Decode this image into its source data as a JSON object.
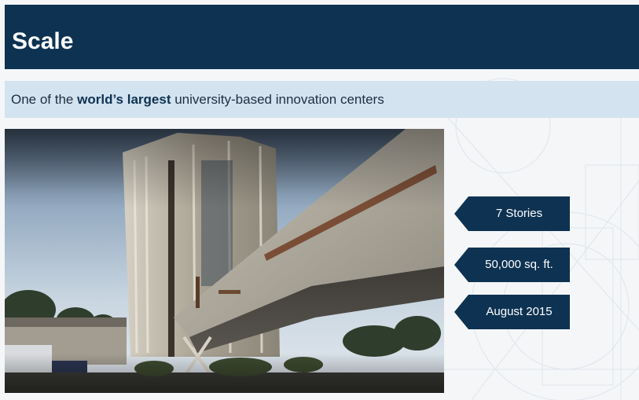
{
  "slide": {
    "title": "Scale",
    "subtitle": {
      "prefix": "One of the ",
      "emphasis": "world’s largest",
      "suffix": " university-based innovation centers"
    }
  },
  "stats": [
    {
      "label": "7 Stories"
    },
    {
      "label": "50,000 sq. ft."
    },
    {
      "label": "August 2015"
    }
  ],
  "colors": {
    "title_bar": "#0e3252",
    "subtitle_bar": "#d3e3f0",
    "stat_tag": "#0e3252"
  }
}
